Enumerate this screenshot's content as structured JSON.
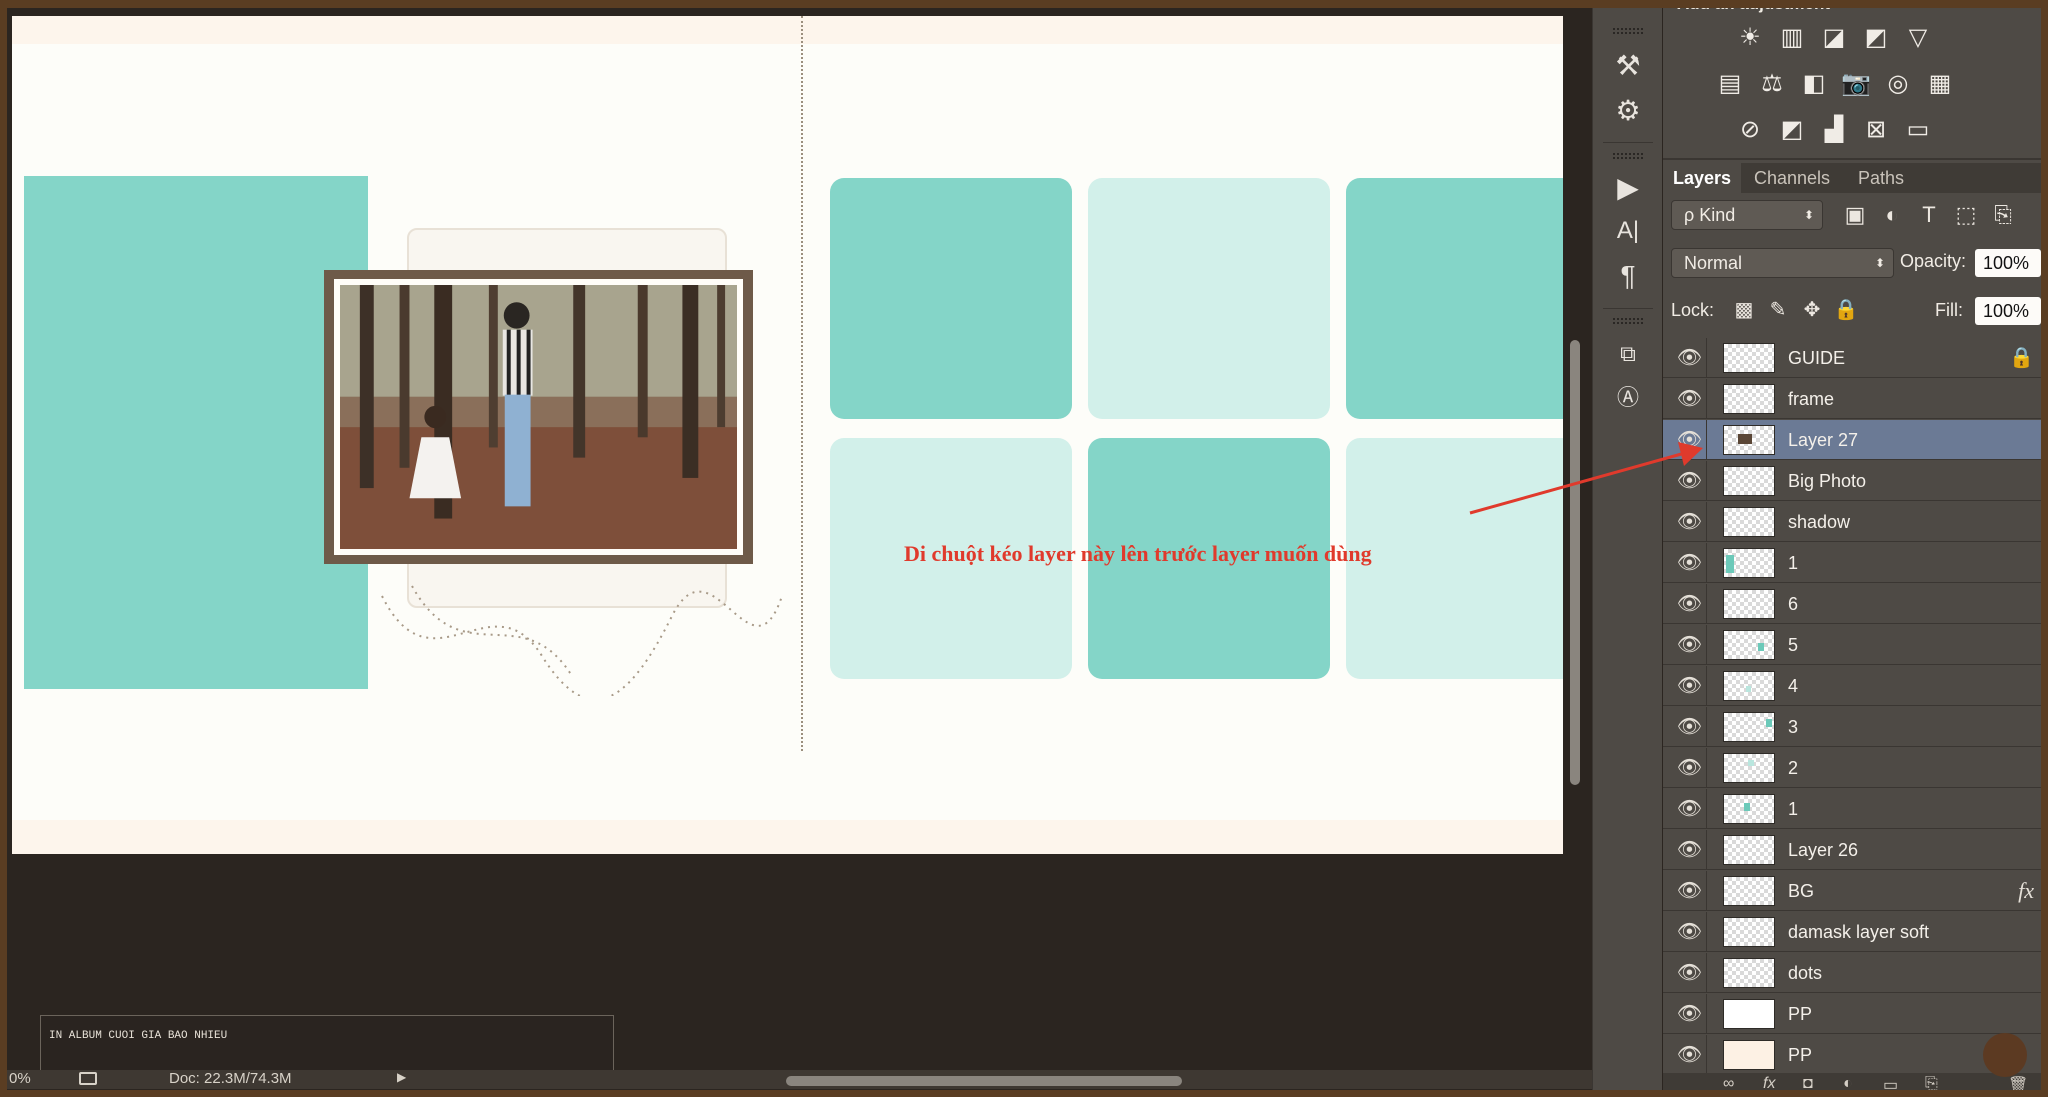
{
  "canvas": {
    "annotation_text": "Di chuột kéo layer này lên trước layer muốn dùng",
    "colors": {
      "teal": "#84d5c8",
      "teal_light": "#d2f0ea",
      "annotation": "#e03a2c"
    }
  },
  "status": {
    "zoom": "0%",
    "doc_info": "Doc: 22.3M/74.3M",
    "ad_text": "IN ALBUM CUOI GIA BAO NHIEU"
  },
  "tools": [
    {
      "name": "brush-tool-icon",
      "glyph": "⚒"
    },
    {
      "name": "adjust-tool-icon",
      "glyph": "⚙"
    },
    {
      "name": "play-action-icon",
      "glyph": "▶"
    },
    {
      "name": "character-panel-icon",
      "glyph": "A|"
    },
    {
      "name": "paragraph-panel-icon",
      "glyph": "¶"
    },
    {
      "name": "paragraph-styles-icon",
      "glyph": "⧉"
    },
    {
      "name": "character-styles-icon",
      "glyph": "Ⓐ"
    }
  ],
  "adjustments": {
    "title": "Add an adjustment",
    "row1": [
      "☀",
      "▥",
      "◪",
      "◩",
      "▽"
    ],
    "row2": [
      "▤",
      "⚖",
      "◧",
      "📷",
      "◎",
      "▦"
    ],
    "row3": [
      "⊘",
      "◩",
      "▟",
      "⊠",
      "▭"
    ]
  },
  "layers_panel": {
    "tabs": [
      "Layers",
      "Channels",
      "Paths"
    ],
    "active_tab": "Layers",
    "kind_label": "ρ Kind",
    "filter_icons": [
      "▣",
      "◐",
      "T",
      "⬚",
      "⎘"
    ],
    "blend_mode": "Normal",
    "opacity_label": "Opacity:",
    "opacity": "100%",
    "lock_label": "Lock:",
    "lock_icons": [
      "▩",
      "✎",
      "✥",
      "🔒"
    ],
    "fill_label": "Fill:",
    "fill": "100%",
    "layers": [
      {
        "name": "GUIDE",
        "badge": "🔒"
      },
      {
        "name": "frame",
        "badge": ""
      },
      {
        "name": "Layer 27",
        "badge": "",
        "selected": true
      },
      {
        "name": "Big Photo",
        "badge": ""
      },
      {
        "name": "shadow",
        "badge": ""
      },
      {
        "name": "1",
        "badge": ""
      },
      {
        "name": "6",
        "badge": ""
      },
      {
        "name": "5",
        "badge": ""
      },
      {
        "name": "4",
        "badge": ""
      },
      {
        "name": "3",
        "badge": ""
      },
      {
        "name": "2",
        "badge": ""
      },
      {
        "name": "1",
        "badge": ""
      },
      {
        "name": "Layer 26",
        "badge": ""
      },
      {
        "name": "BG",
        "badge": "fx"
      },
      {
        "name": "damask layer soft",
        "badge": ""
      },
      {
        "name": "dots",
        "badge": ""
      },
      {
        "name": "PP",
        "badge": ""
      },
      {
        "name": "PP",
        "badge": ""
      }
    ],
    "footer_icons": [
      "∞",
      "fx",
      "◘",
      "◐",
      "▭",
      "⎘",
      "🗑"
    ]
  }
}
